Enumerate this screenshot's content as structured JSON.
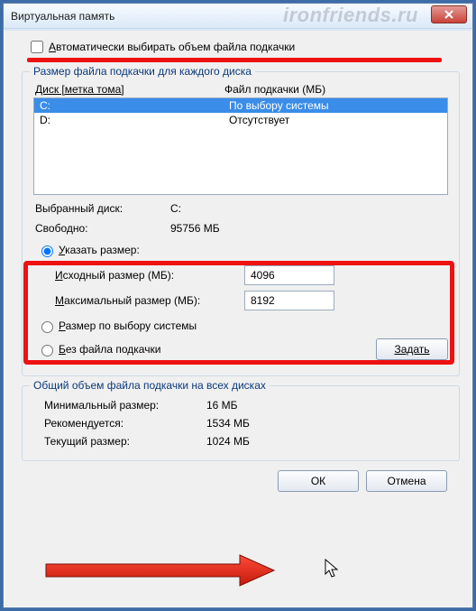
{
  "window": {
    "title": "Виртуальная память",
    "watermark": "ironfriends.ru"
  },
  "auto_checkbox": {
    "label_pre": "А",
    "label_rest": "втоматически выбирать объем файла подкачки",
    "checked": false
  },
  "per_drive_group": {
    "title": "Размер файла подкачки для каждого диска",
    "col_drive": "Диск [метка тома]",
    "col_pf": "Файл подкачки (МБ)",
    "rows": [
      {
        "drive": "C:",
        "pf": "По выбору системы",
        "selected": true
      },
      {
        "drive": "D:",
        "pf": "Отсутствует",
        "selected": false
      }
    ],
    "selected_drive_label": "Выбранный диск:",
    "selected_drive_value": "C:",
    "free_label": "Свободно:",
    "free_value": "95756 МБ",
    "radio_custom": {
      "pre": "У",
      "rest": "казать размер:",
      "checked": true
    },
    "init_label_pre": "И",
    "init_label_rest": "сходный размер (МБ):",
    "init_value": "4096",
    "max_label_pre": "М",
    "max_label_rest": "аксимальный размер (МБ):",
    "max_value": "8192",
    "radio_system": {
      "pre": "Р",
      "rest": "азмер по выбору системы",
      "checked": false
    },
    "radio_none": {
      "pre": "Б",
      "rest": "ез файла подкачки",
      "checked": false
    },
    "set_btn": "Задать"
  },
  "totals_group": {
    "title": "Общий объем файла подкачки на всех дисках",
    "min_label": "Минимальный размер:",
    "min_value": "16 МБ",
    "rec_label": "Рекомендуется:",
    "rec_value": "1534 МБ",
    "cur_label": "Текущий размер:",
    "cur_value": "1024 МБ"
  },
  "buttons": {
    "ok": "ОК",
    "cancel": "Отмена"
  }
}
